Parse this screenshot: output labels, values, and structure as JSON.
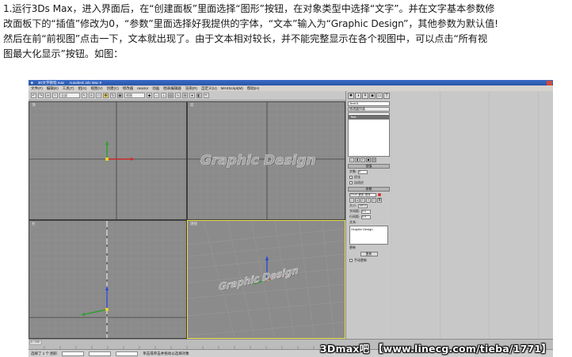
{
  "article": {
    "lines": [
      "1.运行3Ds Max，进入界面后，在“创建面板”里面选择“图形”按钮，在对象类型中选择“文字”。并在文字基本参数修",
      "改面板下的“插值”修改为0，“参数”里面选择好我提供的字体，“文本”输入为“Graphic Design”，其他参数为默认值!",
      "然后在前“前视图”点击一下，文本就出现了。由于文本相对较长，并不能完整显示在各个视图中，可以点击“所有视",
      "图最大化显示”按钮。如图："
    ]
  },
  "app": {
    "title": "3D文字教程.max",
    "title_extra": "Autodesk 3ds Max 9",
    "menus": [
      "文件(F)",
      "编辑(E)",
      "工具(T)",
      "组(G)",
      "视图(V)",
      "创建(C)",
      "修改器",
      "reactor",
      "动画",
      "图表编辑器",
      "渲染(R)",
      "自定义(U)",
      "MAXScript(M)",
      "帮助(H)"
    ],
    "toolbar_dropdown": "全部",
    "toolbar_view_dropdown": "视图"
  },
  "viewports": {
    "top": {
      "label": "顶"
    },
    "front": {
      "label": "前",
      "text": "Graphic Design"
    },
    "left": {
      "label": "左"
    },
    "perspective": {
      "label": "透视",
      "text": "Graphic Design"
    }
  },
  "command_panel": {
    "name_field": "Text01",
    "modifier_list": "修改器列表",
    "stack_item": "Text",
    "rollout_interp": "插值",
    "steps_label": "步数:",
    "steps_value": "0",
    "optimize_label": "优化",
    "adaptive_label": "自适应",
    "rollout_params": "参数",
    "font_field": "ZYUV 隶体-简体",
    "size_label": "大小:",
    "size_value": "100.0",
    "kerning_label": "字间距:",
    "kerning_value": "0.0",
    "leading_label": "行间距:",
    "leading_value": "0.0",
    "text_label": "文本:",
    "text_value": "Graphic Design",
    "update_label": "更新",
    "update_button": "更新",
    "manual_update": "手动更新"
  },
  "status": {
    "selection": "选择了 1 个 图形",
    "prompt": "单击或单击并拖动以选择对象"
  },
  "timeline": {
    "position": "0 / 100"
  },
  "watermark": "3Dmax吧 【www.linecg.com/tieba/1771】"
}
